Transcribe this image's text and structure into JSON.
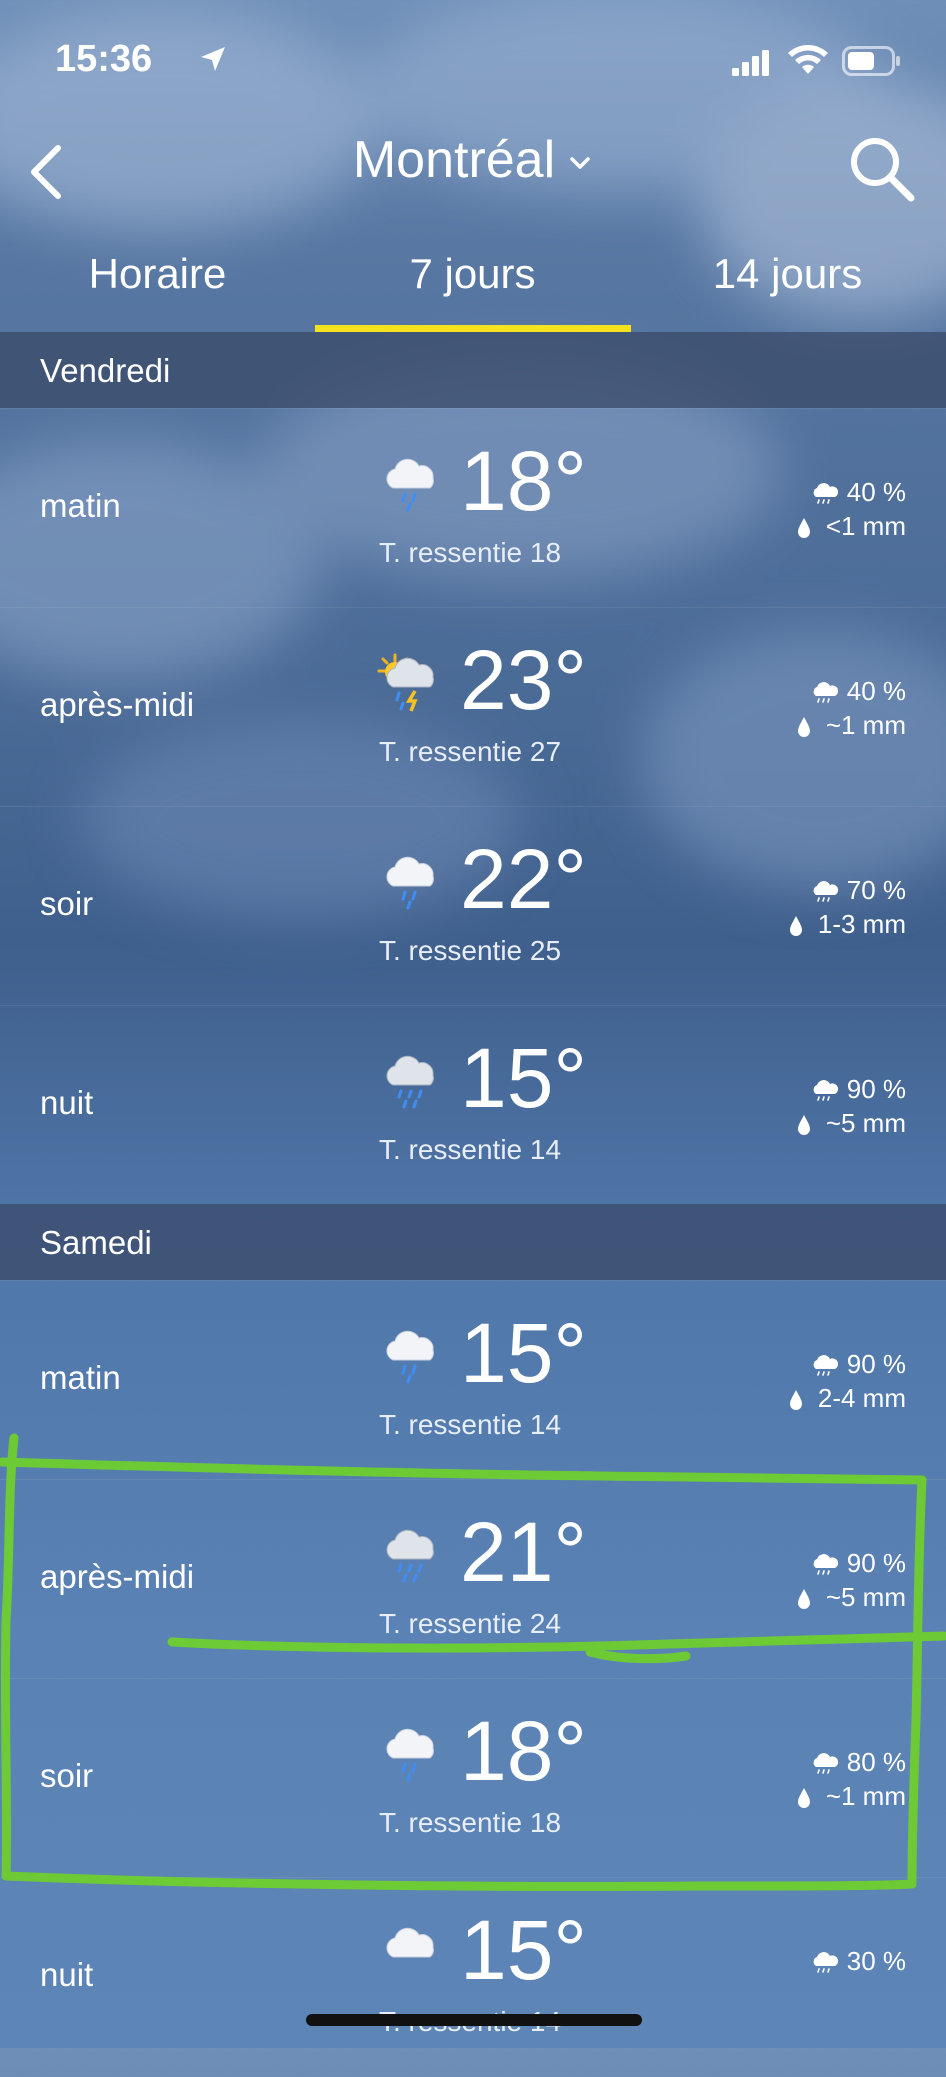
{
  "status": {
    "time": "15:36"
  },
  "header": {
    "city": "Montréal"
  },
  "tabs": [
    "Horaire",
    "7 jours",
    "14 jours"
  ],
  "days": [
    {
      "name": "Vendredi",
      "periods": [
        {
          "period": "matin",
          "temp": "18°",
          "feels": "T. ressentie 18",
          "prob": "40 %",
          "amount": "<1 mm",
          "icon": "cloud-rain-icon"
        },
        {
          "period": "après-midi",
          "temp": "23°",
          "feels": "T. ressentie 27",
          "prob": "40 %",
          "amount": "~1 mm",
          "icon": "sun-cloud-storm-icon"
        },
        {
          "period": "soir",
          "temp": "22°",
          "feels": "T. ressentie 25",
          "prob": "70 %",
          "amount": "1-3 mm",
          "icon": "cloud-rain-icon"
        },
        {
          "period": "nuit",
          "temp": "15°",
          "feels": "T. ressentie 14",
          "prob": "90 %",
          "amount": "~5 mm",
          "icon": "cloud-heavy-rain-icon"
        }
      ]
    },
    {
      "name": "Samedi",
      "periods": [
        {
          "period": "matin",
          "temp": "15°",
          "feels": "T. ressentie 14",
          "prob": "90 %",
          "amount": "2-4 mm",
          "icon": "cloud-rain-icon"
        },
        {
          "period": "après-midi",
          "temp": "21°",
          "feels": "T. ressentie 24",
          "prob": "90 %",
          "amount": "~5 mm",
          "icon": "cloud-heavy-rain-icon"
        },
        {
          "period": "soir",
          "temp": "18°",
          "feels": "T. ressentie 18",
          "prob": "80 %",
          "amount": "~1 mm",
          "icon": "cloud-rain-icon"
        },
        {
          "period": "nuit",
          "temp": "15°",
          "feels": "T. ressentie 14",
          "prob": "30 %",
          "amount": "",
          "icon": "cloud-icon"
        }
      ]
    }
  ],
  "colors": {
    "tab_underline": "#f5e21f",
    "annotation": "#6fd12a"
  }
}
